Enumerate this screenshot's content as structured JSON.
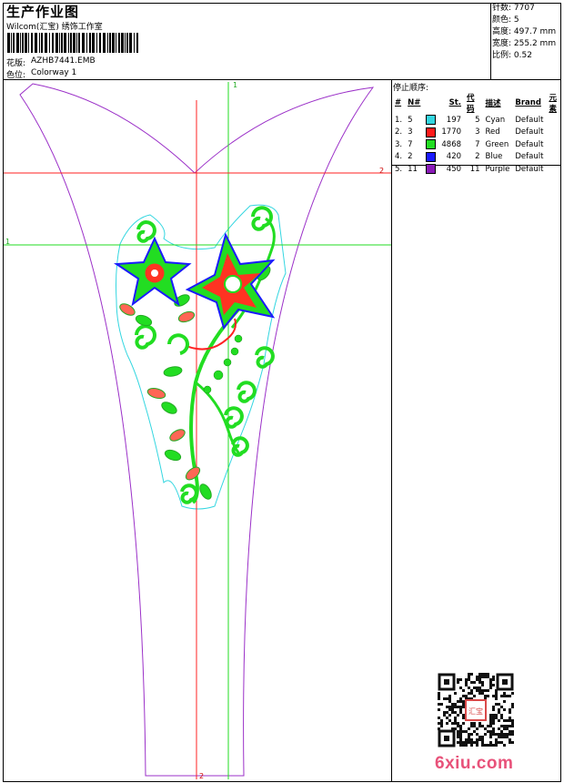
{
  "header": {
    "title": "生产作业图",
    "subtitle": "Wilcom(汇宝) 绣饰工作室",
    "design_label": "花版:",
    "design_value": "AZHB7441.EMB",
    "colorway_label": "色位:",
    "colorway_value": "Colorway 1"
  },
  "stats": [
    {
      "label": "针数:",
      "value": "7707"
    },
    {
      "label": "颜色:",
      "value": "5"
    },
    {
      "label": "高度:",
      "value": "497.7 mm"
    },
    {
      "label": "宽度:",
      "value": "255.2 mm"
    },
    {
      "label": "比例:",
      "value": "0.52"
    }
  ],
  "stop_sequence": {
    "title": "停止顺序:",
    "columns": [
      "#",
      "N#",
      "St.",
      "代码",
      "描述",
      "Brand",
      "元素"
    ],
    "rows": [
      {
        "num": "1.",
        "n": "5",
        "color": "#33d6e0",
        "stitches": "197",
        "code": "5",
        "desc": "Cyan",
        "brand": "Default"
      },
      {
        "num": "2.",
        "n": "3",
        "color": "#ff1a1a",
        "stitches": "1770",
        "code": "3",
        "desc": "Red",
        "brand": "Default"
      },
      {
        "num": "3.",
        "n": "7",
        "color": "#22dd22",
        "stitches": "4868",
        "code": "7",
        "desc": "Green",
        "brand": "Default"
      },
      {
        "num": "4.",
        "n": "2",
        "color": "#1a1aff",
        "stitches": "420",
        "code": "2",
        "desc": "Blue",
        "brand": "Default"
      },
      {
        "num": "5.",
        "n": "11",
        "color": "#8a1ab8",
        "stitches": "450",
        "code": "11",
        "desc": "Purple",
        "brand": "Default"
      }
    ]
  },
  "canvas": {
    "guide_labels": {
      "green_v": "1",
      "red_h": "2",
      "green_h": "1",
      "red_v": "2"
    }
  },
  "watermark": {
    "text": "6xiu.com",
    "seal": "汇宝"
  },
  "icons": {
    "barcode": "barcode-icon",
    "qr": "qr-code-icon",
    "seal": "seal-stamp-icon"
  }
}
